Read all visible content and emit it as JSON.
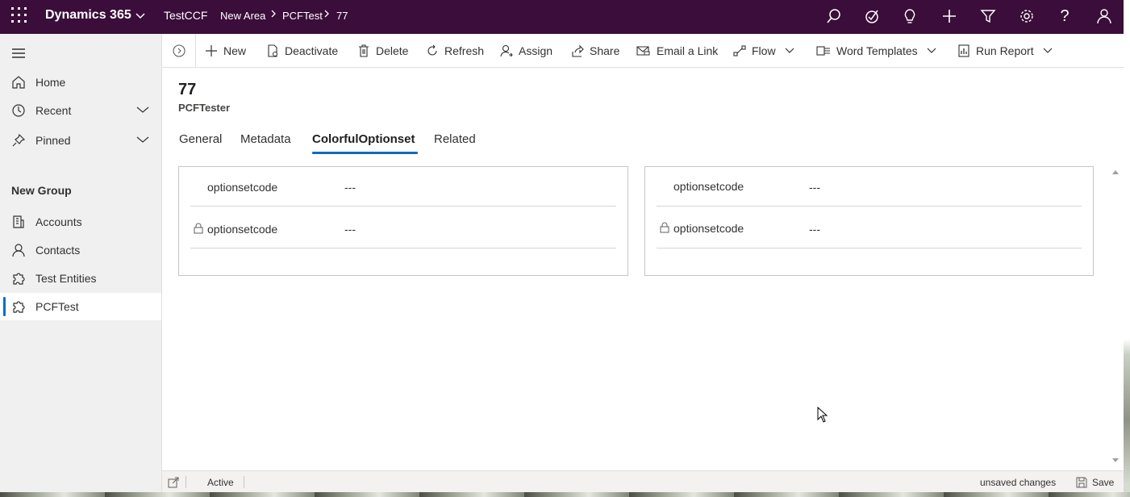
{
  "topbar": {
    "brand": "Dynamics 365",
    "app_name": "TestCCF",
    "breadcrumbs": [
      "New Area",
      "PCFTest",
      "77"
    ],
    "icons": [
      "search-icon",
      "task-icon",
      "lightbulb-icon",
      "plus-icon",
      "filter-icon",
      "gear-icon",
      "help-icon",
      "person-icon"
    ],
    "bg_color": "#3b0d3a"
  },
  "sidebar": {
    "items": [
      {
        "label": "Home",
        "icon": "home-icon"
      },
      {
        "label": "Recent",
        "icon": "clock-icon"
      },
      {
        "label": "Pinned",
        "icon": "pin-icon"
      }
    ],
    "group_title": "New Group",
    "group_items": [
      {
        "label": "Accounts",
        "icon": "accounts-icon"
      },
      {
        "label": "Contacts",
        "icon": "person-icon"
      },
      {
        "label": "Test Entities",
        "icon": "puzzle-icon"
      },
      {
        "label": "PCFTest",
        "icon": "puzzle-icon",
        "selected": true
      }
    ]
  },
  "commands": {
    "new": "New",
    "deactivate": "Deactivate",
    "delete": "Delete",
    "refresh": "Refresh",
    "assign": "Assign",
    "share": "Share",
    "email_link": "Email a Link",
    "flow": "Flow",
    "word_templates": "Word Templates",
    "run_report": "Run Report"
  },
  "record": {
    "title": "77",
    "entity": "PCFTester"
  },
  "tabs": [
    "General",
    "Metadata",
    "ColorfulOptionset",
    "Related"
  ],
  "active_tab": "ColorfulOptionset",
  "sections": [
    {
      "fields": [
        {
          "label": "optionsetcode",
          "value": "---",
          "locked": false
        },
        {
          "label": "optionsetcode",
          "value": "---",
          "locked": true
        }
      ]
    },
    {
      "fields": [
        {
          "label": "optionsetcode",
          "value": "---",
          "locked": false
        },
        {
          "label": "optionsetcode",
          "value": "---",
          "locked": true
        }
      ]
    }
  ],
  "footer": {
    "status": "Active",
    "unsaved": "unsaved changes",
    "save": "Save"
  },
  "colors": {
    "accent": "#0f6cbd"
  }
}
